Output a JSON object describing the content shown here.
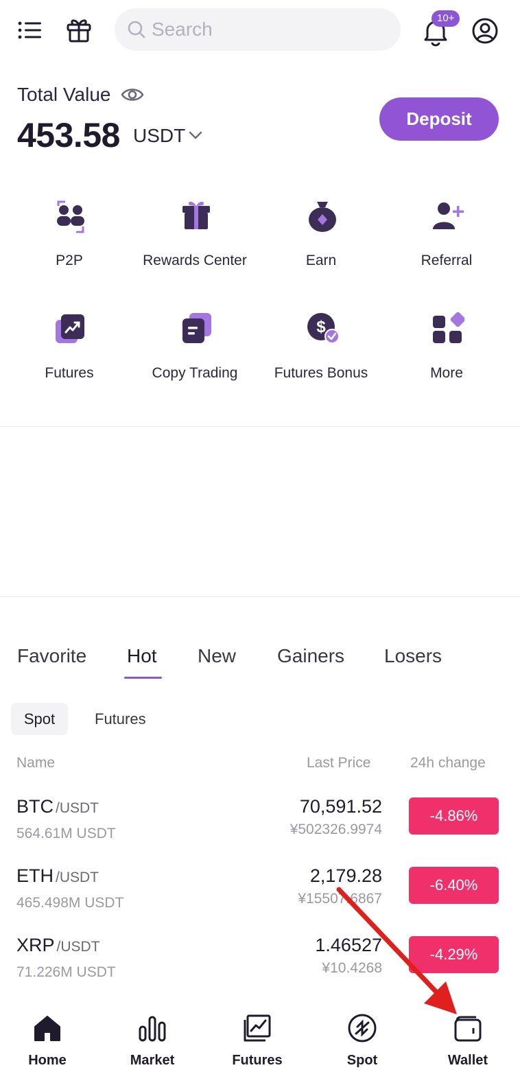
{
  "header": {
    "search_placeholder": "Search",
    "notification_badge": "10+"
  },
  "balance": {
    "label": "Total Value",
    "amount": "453.58",
    "unit": "USDT",
    "deposit_label": "Deposit"
  },
  "shortcuts": [
    {
      "label": "P2P",
      "icon": "p2p-icon"
    },
    {
      "label": "Rewards Center",
      "icon": "gift-box-icon"
    },
    {
      "label": "Earn",
      "icon": "money-bag-icon"
    },
    {
      "label": "Referral",
      "icon": "add-user-icon"
    },
    {
      "label": "Futures",
      "icon": "futures-chart-icon"
    },
    {
      "label": "Copy Trading",
      "icon": "copy-trading-icon"
    },
    {
      "label": "Futures Bonus",
      "icon": "dollar-check-icon"
    },
    {
      "label": "More",
      "icon": "grid-more-icon"
    }
  ],
  "market_tabs": [
    "Favorite",
    "Hot",
    "New",
    "Gainers",
    "Losers"
  ],
  "active_market_tab": "Hot",
  "sub_tabs": [
    "Spot",
    "Futures"
  ],
  "columns": {
    "name": "Name",
    "last_price": "Last Price",
    "change": "24h change"
  },
  "rows": [
    {
      "base": "BTC",
      "quote": "/USDT",
      "volume": "564.61M USDT",
      "price": "70,591.52",
      "cny": "¥502326.9974",
      "change": "-4.86%"
    },
    {
      "base": "ETH",
      "quote": "/USDT",
      "volume": "465.498M USDT",
      "price": "2,179.28",
      "cny": "¥15507.6867",
      "change": "-6.40%"
    },
    {
      "base": "XRP",
      "quote": "/USDT",
      "volume": "71.226M USDT",
      "price": "1.46527",
      "cny": "¥10.4268",
      "change": "-4.29%"
    }
  ],
  "bottom_nav": [
    {
      "label": "Home",
      "icon": "home-icon"
    },
    {
      "label": "Market",
      "icon": "bar-chart-icon"
    },
    {
      "label": "Futures",
      "icon": "line-chart-icon"
    },
    {
      "label": "Spot",
      "icon": "spot-icon"
    },
    {
      "label": "Wallet",
      "icon": "wallet-icon"
    }
  ],
  "colors": {
    "accent": "#9154d4",
    "negative": "#f0306a",
    "text_dark": "#1f1b2d",
    "icon_dark": "#3b2d55",
    "annotation_arrow": "#e0201c"
  }
}
